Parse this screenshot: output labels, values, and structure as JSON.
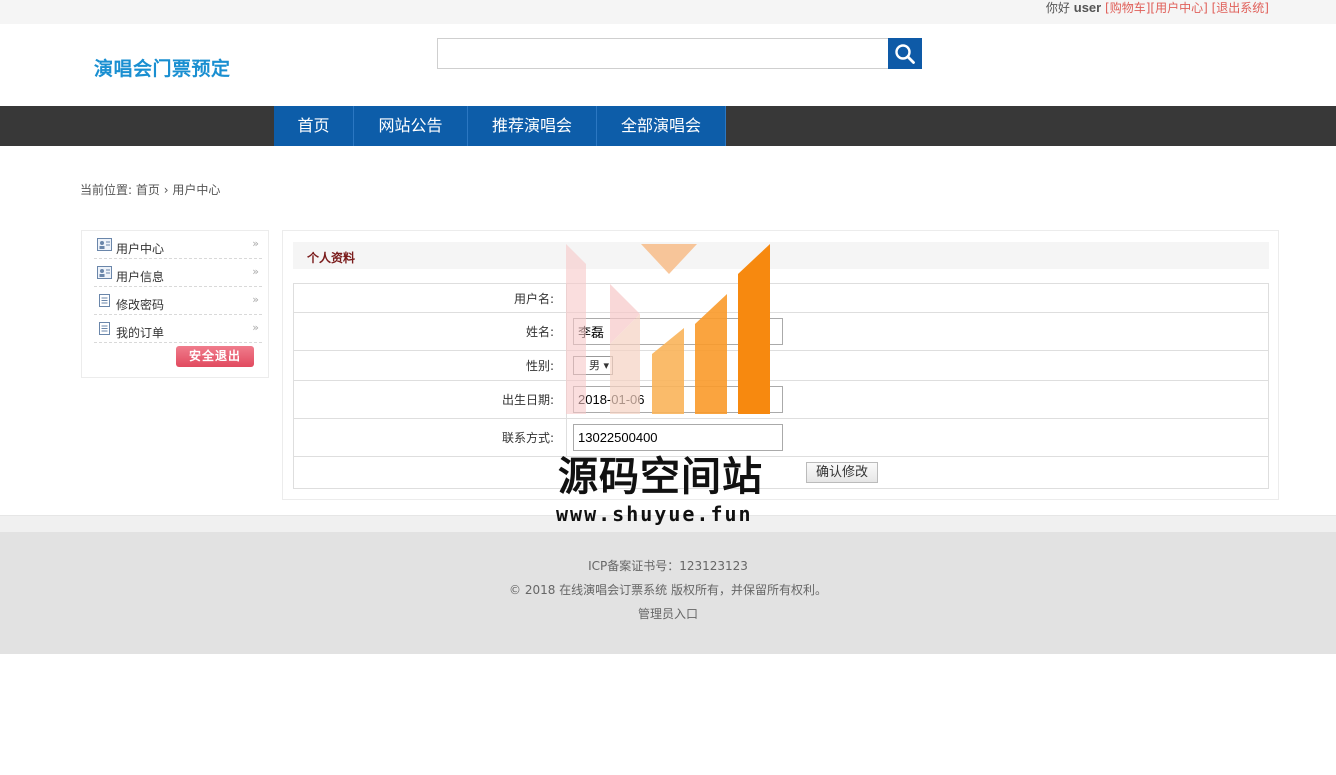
{
  "topbar": {
    "greeting": "你好",
    "username": "user",
    "links": [
      "[购物车]",
      "[用户中心]",
      "[退出系统]"
    ]
  },
  "header": {
    "logo": "演唱会门票预定",
    "search": {
      "value": "",
      "placeholder": ""
    },
    "search_icon": "search-icon"
  },
  "nav": {
    "items": [
      "首页",
      "网站公告",
      "推荐演唱会",
      "全部演唱会"
    ]
  },
  "breadcrumb": {
    "prefix": "当前位置:",
    "home": "首页",
    "separator": "›",
    "current": "用户中心"
  },
  "sidebar": {
    "items": [
      {
        "label": "用户中心",
        "icon": "user-card-icon"
      },
      {
        "label": "用户信息",
        "icon": "user-card-icon"
      },
      {
        "label": "修改密码",
        "icon": "document-icon"
      },
      {
        "label": "我的订单",
        "icon": "document-icon"
      }
    ],
    "arrow": "»",
    "logout_label": "安全退出"
  },
  "profile": {
    "title": "个人资料",
    "fields": {
      "username_label": "用户名:",
      "name_label": "姓名:",
      "name_value": "李磊",
      "gender_label": "性别:",
      "gender_value": "男",
      "birthday_label": "出生日期:",
      "birthday_value": "2018-01-06",
      "phone_label": "联系方式:",
      "phone_value": "13022500400"
    },
    "submit_label": "确认修改"
  },
  "footer": {
    "icp": "ICP备案证书号：123123123",
    "copyright": "© 2018 在线演唱会订票系统 版权所有，并保留所有权利。",
    "admin_link": "管理员入口"
  },
  "watermark": {
    "text": "源码空间站",
    "url": "www.shuyue.fun"
  },
  "colors": {
    "brand_blue": "#0d5da9",
    "logo_blue": "#1a8fd1",
    "nav_dark": "#383838",
    "link_red": "#e0605a",
    "watermark_orange": "#f7890f"
  }
}
